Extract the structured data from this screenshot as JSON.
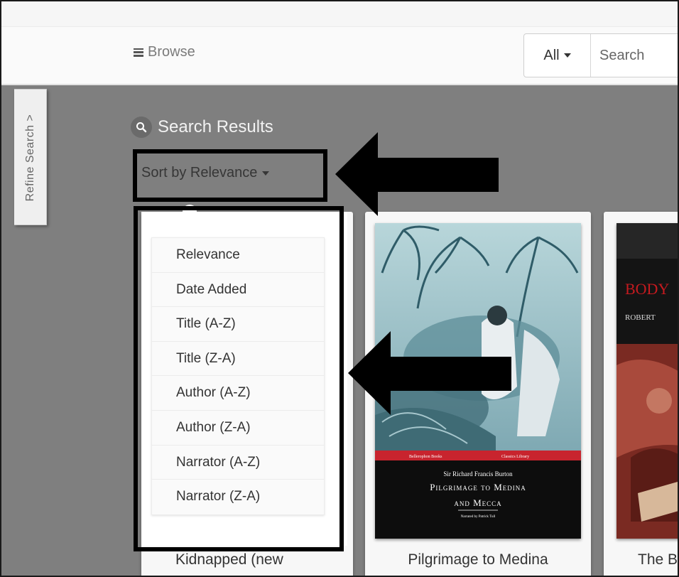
{
  "header": {
    "browse_label": "Browse",
    "search": {
      "scope": "All",
      "placeholder": "Search"
    }
  },
  "sidebar": {
    "refine_label": "Refine Search",
    "refine_chevron": ">"
  },
  "results": {
    "title": "Search Results",
    "sort_label": "Sort by Relevance"
  },
  "sort_menu": {
    "items": [
      "Relevance",
      "Date Added",
      "Title (A-Z)",
      "Title (Z-A)",
      "Author (A-Z)",
      "Author (Z-A)",
      "Narrator (A-Z)",
      "Narrator (Z-A)"
    ]
  },
  "cards": [
    {
      "caption": "Kidnapped (new"
    },
    {
      "caption": "Pilgrimage to Medina",
      "cover": {
        "series": "Bellerophon Books",
        "library": "Classics Library",
        "author": "Sir Richard Francis Burton",
        "title_line1": "Pilgrimage to Medina",
        "title_line2": "and Mecca",
        "narrator": "Narrated by Patrick Tull"
      }
    },
    {
      "caption": "The B",
      "cover": {
        "title": "BODY",
        "author": "ROBERT"
      }
    }
  ],
  "icons": {
    "menu": "hamburger-icon",
    "search": "magnifier-icon",
    "caret": "caret-down-icon",
    "annotation_arrow": "arrow-left-icon"
  },
  "colors": {
    "page_bg": "#7f7f7f",
    "header_bg": "#fafafa",
    "card_bg": "#f7f7f7",
    "annotation": "#000000",
    "cover_red_band": "#c8242e"
  }
}
